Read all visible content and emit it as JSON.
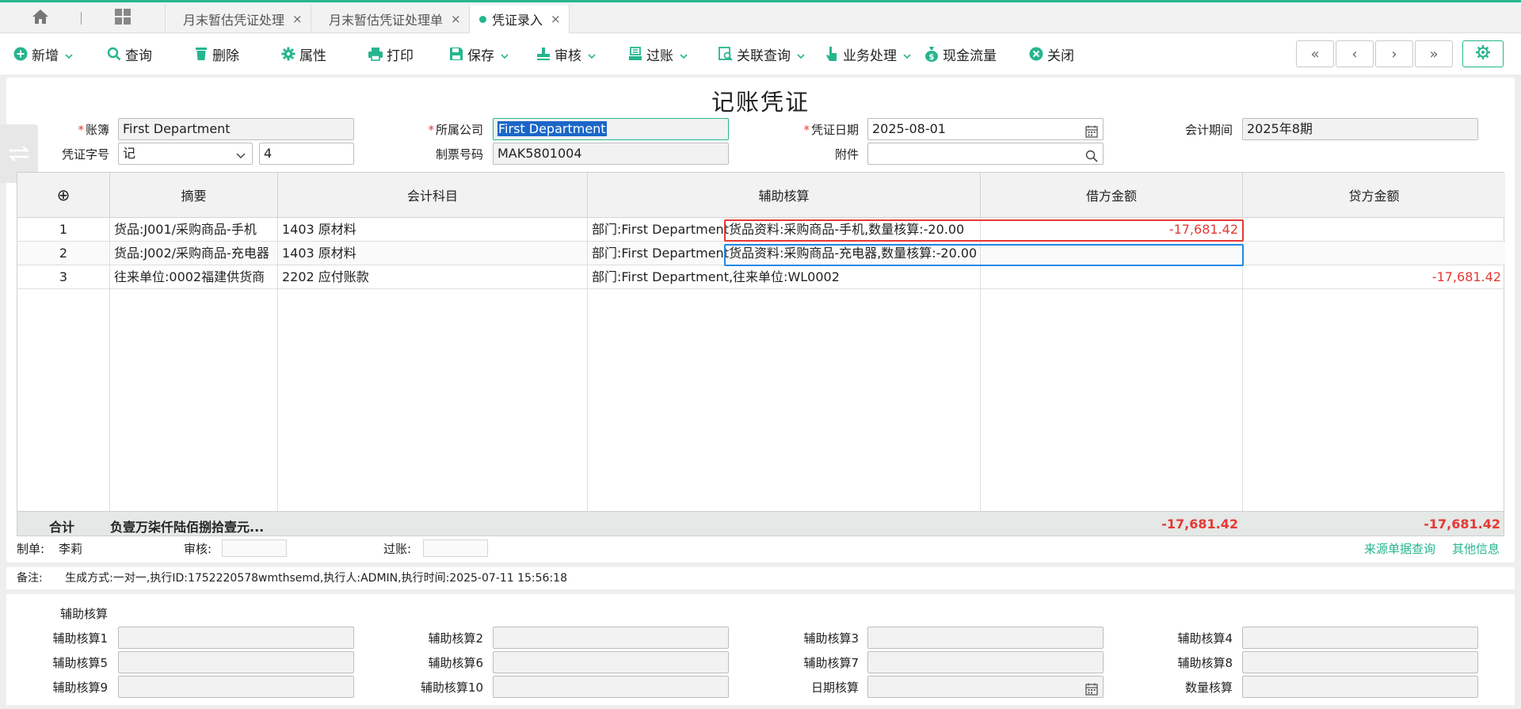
{
  "tabs": {
    "items": [
      {
        "label": "月末暂估凭证处理",
        "close": "×"
      },
      {
        "label": "月末暂估凭证处理单",
        "close": "×"
      },
      {
        "label": "凭证录入",
        "close": "×"
      }
    ]
  },
  "toolbar": {
    "add": "新增",
    "query": "查询",
    "delete": "删除",
    "properties": "属性",
    "print": "打印",
    "save": "保存",
    "review": "审核",
    "post": "过账",
    "related_query": "关联查询",
    "business": "业务处理",
    "cash_flow": "现金流量",
    "close": "关闭",
    "nav_first": "«",
    "nav_prev": "‹",
    "nav_next": "›",
    "nav_last": "»"
  },
  "form": {
    "title": "记账凭证",
    "ledger_label": "账簿",
    "ledger_value": "First Department",
    "company_label": "所属公司",
    "company_value": "First Department",
    "date_label": "凭证日期",
    "date_value": "2025-08-01",
    "period_label": "会计期间",
    "period_value": "2025年8期",
    "voucher_word_label": "凭证字号",
    "voucher_word_value": "记",
    "voucher_no_value": "4",
    "invoice_label": "制票号码",
    "invoice_value": "MAK5801004",
    "attachment_label": "附件",
    "attachment_value": ""
  },
  "grid": {
    "add_symbol": "⊕",
    "headers": [
      "摘要",
      "会计科目",
      "辅助核算",
      "借方金额",
      "贷方金额"
    ],
    "rows": [
      {
        "no": "1",
        "summary": "货品:J001/采购商品-手机",
        "account": "1403 原材料",
        "aux_dept": "部门:First Department",
        "aux_rest": "货品资料:采购商品-手机,数量核算:-20.00",
        "debit": "-17,681.42",
        "credit": ""
      },
      {
        "no": "2",
        "summary": "货品:J002/采购商品-充电器",
        "account": "1403 原材料",
        "aux_dept": "部门:First Department",
        "aux_rest": "货品资料:采购商品-充电器,数量核算:-20.00",
        "debit": "",
        "credit": ""
      },
      {
        "no": "3",
        "summary": "往来单位:0002福建供货商",
        "account": "2202 应付账款",
        "aux_dept": "部门:First Department,往来单位:WL0002",
        "aux_rest": "",
        "debit": "",
        "credit": "-17,681.42"
      }
    ],
    "total_label": "合计",
    "total_words": "负壹万柒仟陆佰捌拾壹元...",
    "total_debit": "-17,681.42",
    "total_credit": "-17,681.42"
  },
  "signature": {
    "maker_label": "制单:",
    "maker_value": "李莉",
    "reviewer_label": "审核:",
    "poster_label": "过账:",
    "source_query": "来源单据查询",
    "other_info": "其他信息"
  },
  "remark": {
    "label": "备注:",
    "text": "生成方式:一对一,执行ID:1752220578wmthsemd,执行人:ADMIN,执行时间:2025-07-11 15:56:18"
  },
  "aux": {
    "title": "辅助核算",
    "labels": [
      "辅助核算1",
      "辅助核算2",
      "辅助核算3",
      "辅助核算4",
      "辅助核算5",
      "辅助核算6",
      "辅助核算7",
      "辅助核算8",
      "辅助核算9",
      "辅助核算10",
      "日期核算",
      "数量核算"
    ]
  },
  "colors": {
    "accent": "#26b58e",
    "negative": "#e53935",
    "focus_blue": "#1e88e5"
  }
}
